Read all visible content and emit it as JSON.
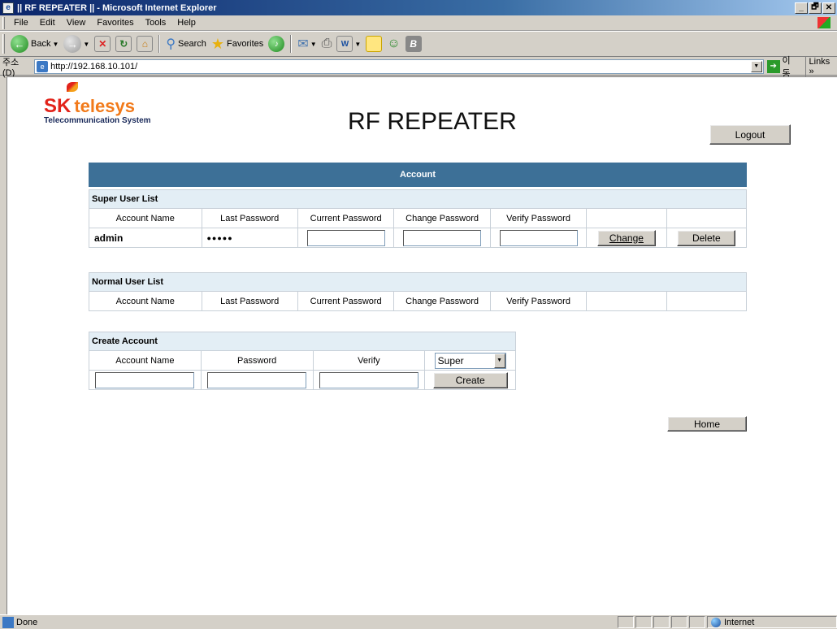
{
  "window": {
    "title": "|| RF REPEATER || - Microsoft Internet Explorer",
    "min": "_",
    "max": "🗗",
    "close": "✕"
  },
  "menu": [
    "File",
    "Edit",
    "View",
    "Favorites",
    "Tools",
    "Help"
  ],
  "toolbar": {
    "back": "Back",
    "search": "Search",
    "favorites": "Favorites"
  },
  "address": {
    "label": "주소(D)",
    "url": "http://192.168.10.101/",
    "go": "이동",
    "links": "Links"
  },
  "page": {
    "logo_sk": "SK",
    "logo_telesys": "telesys",
    "logo_sub": "Telecommunication System",
    "title": "RF REPEATER",
    "logout": "Logout",
    "account_header": "Account",
    "super_list": {
      "caption": "Super User List",
      "columns": [
        "Account Name",
        "Last Password",
        "Current Password",
        "Change Password",
        "Verify Password",
        "",
        ""
      ],
      "rows": [
        {
          "name": "admin",
          "last_password": "●●●●●",
          "change": "Change",
          "delete": "Delete"
        }
      ]
    },
    "normal_list": {
      "caption": "Normal User List",
      "columns": [
        "Account Name",
        "Last Password",
        "Current Password",
        "Change Password",
        "Verify Password",
        "",
        ""
      ]
    },
    "create": {
      "caption": "Create Account",
      "columns": [
        "Account Name",
        "Password",
        "Verify"
      ],
      "level_selected": "Super",
      "create_button": "Create"
    },
    "home": "Home"
  },
  "status": {
    "text": "Done",
    "zone": "Internet"
  }
}
